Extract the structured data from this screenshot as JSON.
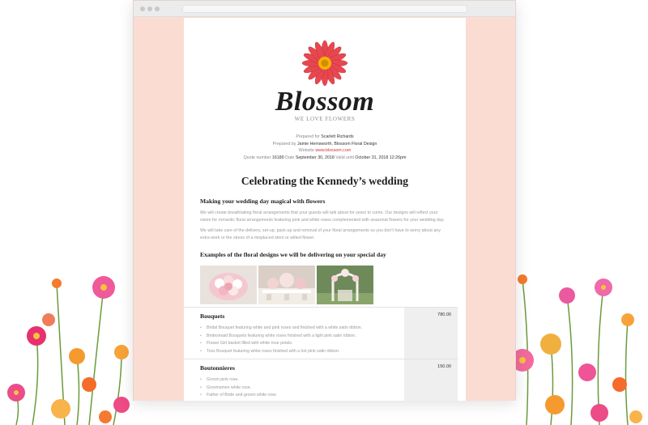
{
  "brand": {
    "name": "Blossom",
    "tagline": "WE LOVE FLOWERS"
  },
  "meta": {
    "prepared_for_label": "Prepared for",
    "prepared_for": "Scarlett Richards",
    "prepared_by_label": "Prepared by",
    "prepared_by": "Jamie Hemsworth, Blossom Floral Design",
    "website_label": "Website",
    "website": "www.blossom.com",
    "quote_number_label": "Quote number",
    "quote_number": "16180",
    "date_label": "Date",
    "date": "September 30, 2018",
    "valid_until_label": "Valid until",
    "valid_until": "October 31, 2018 12:26pm"
  },
  "doc": {
    "title": "Celebrating the Kennedy’s wedding",
    "section1_heading": "Making your wedding day magical with flowers",
    "para1": "We will create breathtaking floral arrangements that your guests will talk about for years to come. Our designs will reflect your vision for romantic floral arrangements featuring pink and white roses complemented with seasonal flowers for your wedding day.",
    "para2": "We will take care of the delivery, set-up, pack-up and removal of your floral arrangements so you don’t have to worry about any extra work or the stress of a misplaced stem or wilted flower.",
    "section2_heading": "Examples of the floral designs we will be delivering on your special day"
  },
  "pricing": {
    "rows": [
      {
        "title": "Bouquets",
        "price": "780.00",
        "items": [
          "Bridal Bouquet featuring white and pink roses and finished with a white satin ribbon.",
          "Bridesmaid Bouquets featuring white roses finished with a light pink satin ribbon.",
          "Flower Girl basket filled with white rose petals.",
          "Toss Bouquet featuring white roses finished with a hot pink satin ribbon."
        ]
      },
      {
        "title": "Boutonnieres",
        "price": "150.00",
        "items": [
          "Groom pink rose.",
          "Groomsmen white rose.",
          "Father of Bride and groom white rose."
        ]
      }
    ]
  },
  "colors": {
    "page_bg": "#fbdcd3",
    "accent_red": "#d0343c",
    "flower_petal": "#e8474f",
    "flower_center": "#f5b400"
  },
  "icons": [
    "logo-flower",
    "browser-window-dots"
  ]
}
